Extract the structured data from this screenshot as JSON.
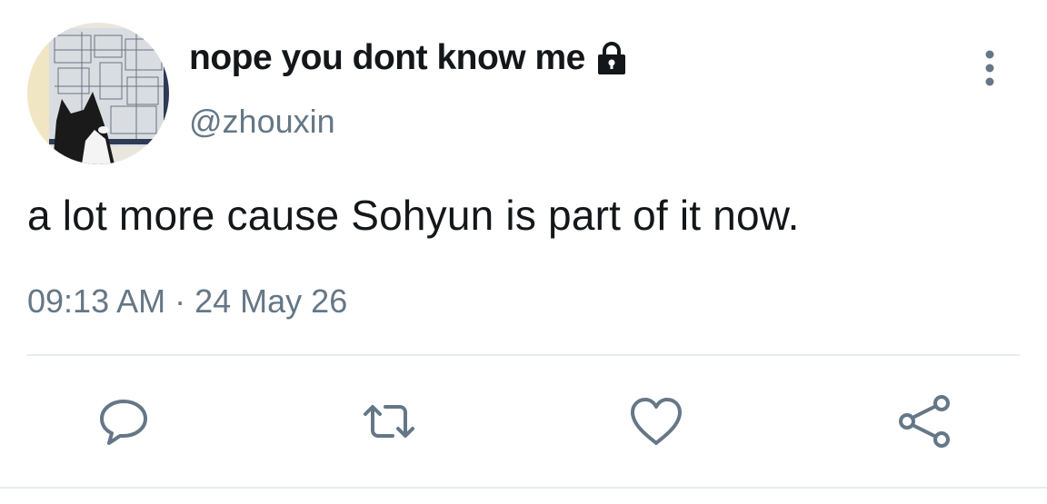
{
  "tweet": {
    "display_name": "nope you dont know me",
    "handle": "@zhouxin",
    "text": "a lot more cause Sohyun is part of it now.",
    "time": "09:13 AM",
    "separator": " · ",
    "date": "24 May 26",
    "protected_icon": "lock-icon",
    "more_icon": "vertical-ellipsis-icon"
  },
  "actions": [
    {
      "name": "reply",
      "icon": "reply-icon"
    },
    {
      "name": "retweet",
      "icon": "retweet-icon"
    },
    {
      "name": "like",
      "icon": "heart-icon"
    },
    {
      "name": "share",
      "icon": "share-icon"
    }
  ],
  "colors": {
    "text_primary": "#14171a",
    "text_secondary": "#657786",
    "icon": "#657786",
    "divider": "#e6ecf0"
  }
}
